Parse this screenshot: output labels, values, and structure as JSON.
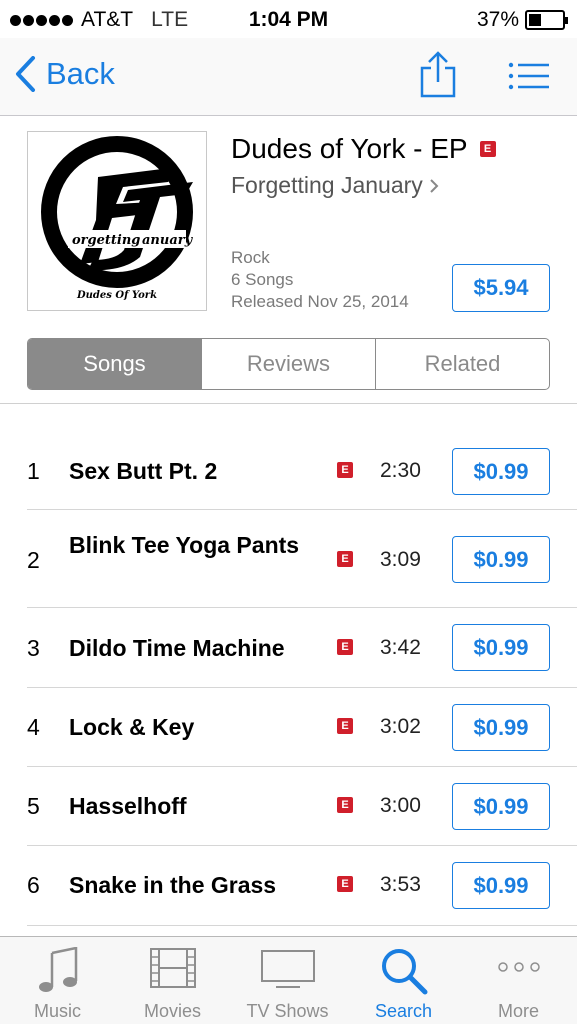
{
  "status": {
    "carrier": "AT&T",
    "network": "LTE",
    "time": "1:04 PM",
    "battery": "37%",
    "battery_level": 0.37
  },
  "nav": {
    "back_label": "Back",
    "accent": "#1a7ee0"
  },
  "album": {
    "title": "Dudes of York - EP",
    "explicit_badge": "E",
    "artist": "Forgetting January",
    "art_caption": "Dudes Of York",
    "logo_text_left": "orgetting",
    "logo_text_right": "anuary",
    "genre": "Rock",
    "song_count": "6 Songs",
    "released": "Released Nov 25, 2014",
    "price": "$5.94"
  },
  "segments": [
    {
      "label": "Songs",
      "active": true
    },
    {
      "label": "Reviews",
      "active": false
    },
    {
      "label": "Related",
      "active": false
    }
  ],
  "songs": [
    {
      "num": "1",
      "title": "Sex Butt Pt. 2",
      "explicit": "E",
      "duration": "2:30",
      "price": "$0.99"
    },
    {
      "num": "2",
      "title": "Blink Tee Yoga Pants",
      "explicit": "E",
      "duration": "3:09",
      "price": "$0.99"
    },
    {
      "num": "3",
      "title": "Dildo Time Machine",
      "explicit": "E",
      "duration": "3:42",
      "price": "$0.99"
    },
    {
      "num": "4",
      "title": "Lock & Key",
      "explicit": "E",
      "duration": "3:02",
      "price": "$0.99"
    },
    {
      "num": "5",
      "title": "Hasselhoff",
      "explicit": "E",
      "duration": "3:00",
      "price": "$0.99"
    },
    {
      "num": "6",
      "title": "Snake in the Grass",
      "explicit": "E",
      "duration": "3:53",
      "price": "$0.99"
    }
  ],
  "tabs": [
    {
      "label": "Music",
      "icon": "music-note-icon",
      "active": false
    },
    {
      "label": "Movies",
      "icon": "film-strip-icon",
      "active": false
    },
    {
      "label": "TV Shows",
      "icon": "tv-icon",
      "active": false
    },
    {
      "label": "Search",
      "icon": "search-icon",
      "active": true
    },
    {
      "label": "More",
      "icon": "more-dots-icon",
      "active": false
    }
  ]
}
